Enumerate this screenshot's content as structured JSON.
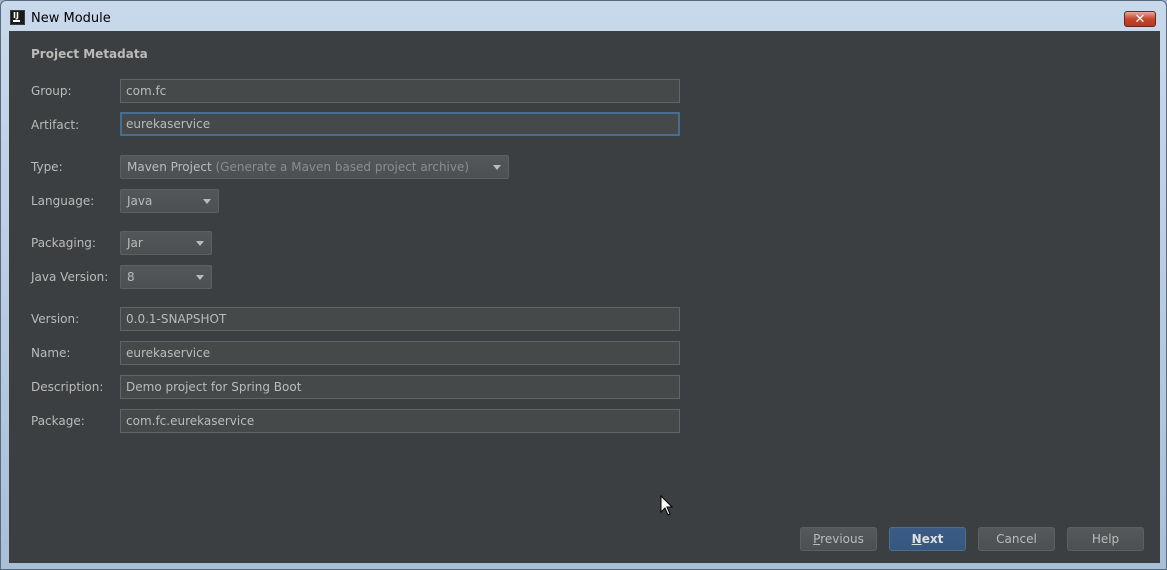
{
  "window": {
    "title": "New Module",
    "app_icon_text": "IJ",
    "close_symbol": "✕"
  },
  "section_title": "Project Metadata",
  "form": {
    "group": {
      "label": "Group:",
      "value": "com.fc"
    },
    "artifact": {
      "label": "Artifact:",
      "value": "eurekaservice"
    },
    "type": {
      "label": "Type:",
      "value": "Maven Project",
      "hint": "(Generate a Maven based project archive)"
    },
    "language": {
      "label": "Language:",
      "value": "Java"
    },
    "packaging": {
      "label": "Packaging:",
      "value": "Jar"
    },
    "java_version": {
      "label": "Java Version:",
      "value": "8"
    },
    "version": {
      "label": "Version:",
      "value": "0.0.1-SNAPSHOT"
    },
    "name": {
      "label": "Name:",
      "value": "eurekaservice"
    },
    "description": {
      "label": "Description:",
      "value": "Demo project for Spring Boot"
    },
    "package": {
      "label": "Package:",
      "value": "com.fc.eurekaservice"
    }
  },
  "buttons": {
    "previous": {
      "mnemonic": "P",
      "rest": "revious"
    },
    "next": {
      "mnemonic": "N",
      "rest": "ext"
    },
    "cancel": "Cancel",
    "help": "Help"
  },
  "colors": {
    "dialog_bg": "#3c3f41",
    "field_bg": "#45494a",
    "focus_border": "#466d94",
    "primary_button": "#365880",
    "text": "#bbbbbb"
  }
}
